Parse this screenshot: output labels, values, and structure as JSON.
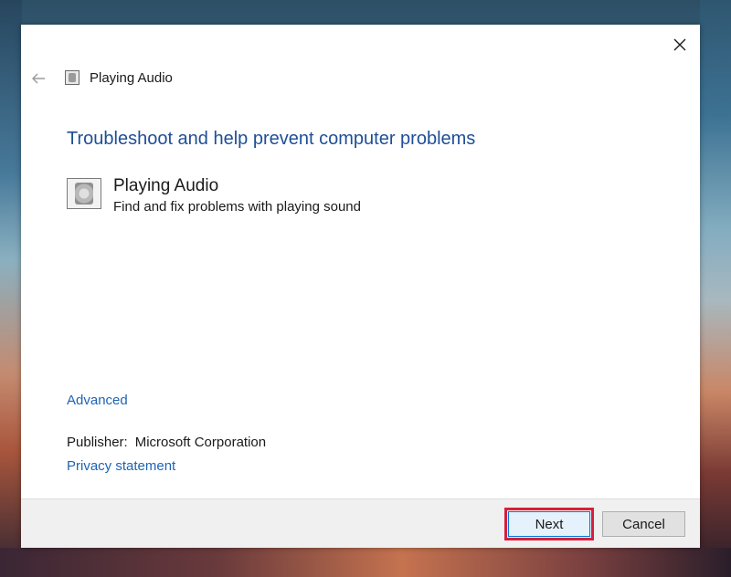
{
  "window": {
    "title": "Playing Audio",
    "close_icon": "close-icon",
    "back_icon": "back-arrow-icon"
  },
  "main": {
    "heading": "Troubleshoot and help prevent computer problems",
    "item": {
      "icon": "speaker-icon",
      "title": "Playing Audio",
      "description": "Find and fix problems with playing sound"
    },
    "advanced_link": "Advanced",
    "publisher_label": "Publisher:",
    "publisher_value": "Microsoft Corporation",
    "privacy_link": "Privacy statement"
  },
  "footer": {
    "next_label": "Next",
    "cancel_label": "Cancel"
  },
  "colors": {
    "heading": "#1e4f96",
    "link": "#1e64b4",
    "highlight": "#d81f3c"
  }
}
